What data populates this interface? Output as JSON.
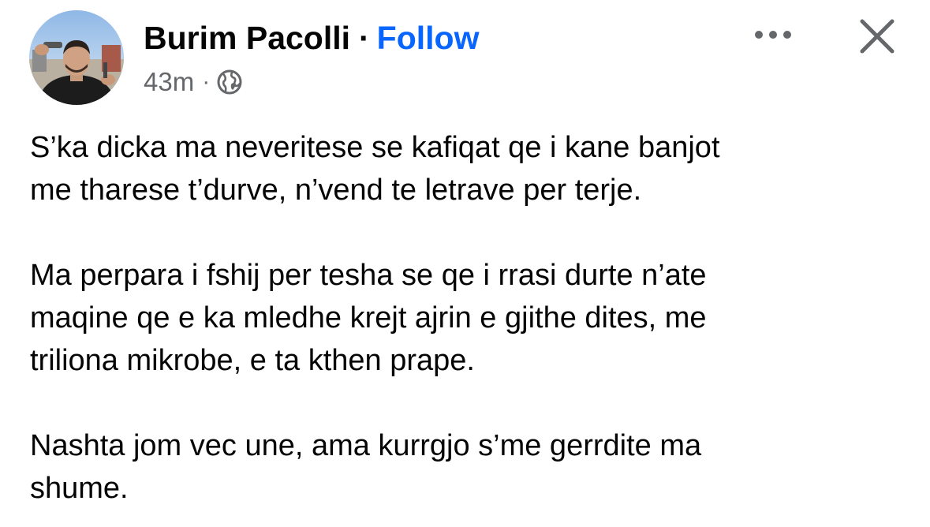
{
  "post": {
    "author": "Burim Pacolli",
    "separator": "·",
    "follow_label": "Follow",
    "timestamp": "43m",
    "meta_separator": "·",
    "audience_icon": "globe-icon",
    "more_icon": "more-horizontal-icon",
    "close_icon": "close-icon",
    "paragraphs": [
      "S’ka dicka ma neveritese se kafiqat qe i kane banjot\nme tharese t’durve, n’vend te letrave per terje.",
      "Ma perpara i fshij per tesha se qe i rrasi durte n’ate\nmaqine qe e ka mledhe krejt ajrin e gjithe dites, me\ntriliona mikrobe, e ta kthen prape.",
      "Nashta jom vec une, ama kurrgjo s’me gerrdite ma\nshume."
    ]
  },
  "colors": {
    "link": "#0866ff",
    "text": "#050505",
    "secondary": "#65676b"
  }
}
